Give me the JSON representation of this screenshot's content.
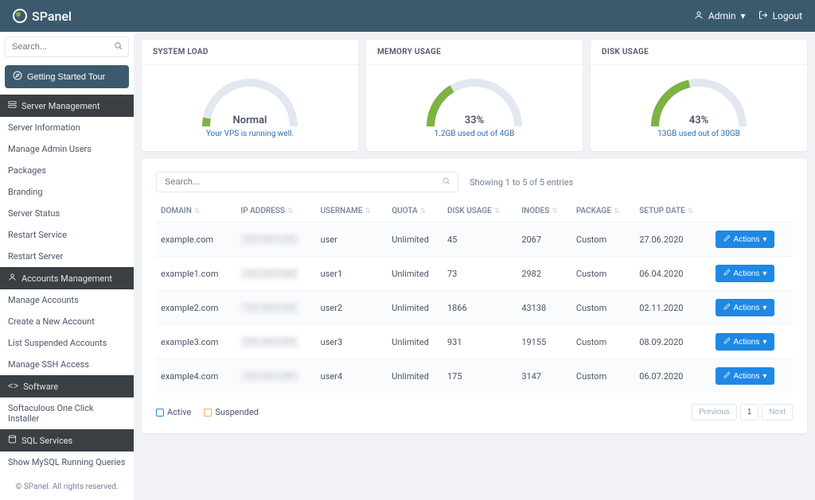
{
  "header": {
    "brand": "SPanel",
    "user_label": "Admin",
    "logout": "Logout"
  },
  "sidebar": {
    "search_placeholder": "Search...",
    "tour": "Getting Started Tour",
    "sections": [
      {
        "title": "Server Management",
        "items": [
          "Server Information",
          "Manage Admin Users",
          "Packages",
          "Branding",
          "Server Status",
          "Restart Service",
          "Restart Server"
        ]
      },
      {
        "title": "Accounts Management",
        "items": [
          "Manage Accounts",
          "Create a New Account",
          "List Suspended Accounts",
          "Manage SSH Access"
        ]
      },
      {
        "title": "Software",
        "items": [
          "Softaculous One Click Installer"
        ]
      },
      {
        "title": "SQL Services",
        "items": [
          "Show MySQL Running Queries"
        ]
      }
    ],
    "footer": "© SPanel. All rights reserved."
  },
  "cards": {
    "system_load": {
      "title": "SYSTEM LOAD",
      "status": "Normal",
      "sub": "Your VPS is running well.",
      "pct": 6
    },
    "memory": {
      "title": "MEMORY USAGE",
      "status": "33%",
      "sub": "1.2GB used out of 4GB",
      "pct": 33
    },
    "disk": {
      "title": "DISK USAGE",
      "status": "43%",
      "sub": "13GB used out of 30GB",
      "pct": 43
    }
  },
  "table": {
    "search_placeholder": "Search...",
    "entries": "Showing 1 to 5 of 5 entries",
    "headers": [
      "DOMAIN",
      "IP ADDRESS",
      "USERNAME",
      "QUOTA",
      "DISK USAGE",
      "INODES",
      "PACKAGE",
      "SETUP DATE",
      ""
    ],
    "action_label": "Actions",
    "rows": [
      {
        "domain": "example.com",
        "username": "user",
        "quota": "Unlimited",
        "disk": "45",
        "inodes": "2067",
        "package": "Custom",
        "date": "27.06.2020"
      },
      {
        "domain": "example1.com",
        "username": "user1",
        "quota": "Unlimited",
        "disk": "73",
        "inodes": "2982",
        "package": "Custom",
        "date": "06.04.2020"
      },
      {
        "domain": "example2.com",
        "username": "user2",
        "quota": "Unlimited",
        "disk": "1866",
        "inodes": "43138",
        "package": "Custom",
        "date": "02.11.2020"
      },
      {
        "domain": "example3.com",
        "username": "user3",
        "quota": "Unlimited",
        "disk": "931",
        "inodes": "19155",
        "package": "Custom",
        "date": "08.09.2020"
      },
      {
        "domain": "example4.com",
        "username": "user4",
        "quota": "Unlimited",
        "disk": "175",
        "inodes": "3147",
        "package": "Custom",
        "date": "06.07.2020"
      }
    ],
    "legend": {
      "active": "Active",
      "suspended": "Suspended"
    },
    "pagination": {
      "prev": "Previous",
      "page": "1",
      "next": "Next"
    }
  }
}
